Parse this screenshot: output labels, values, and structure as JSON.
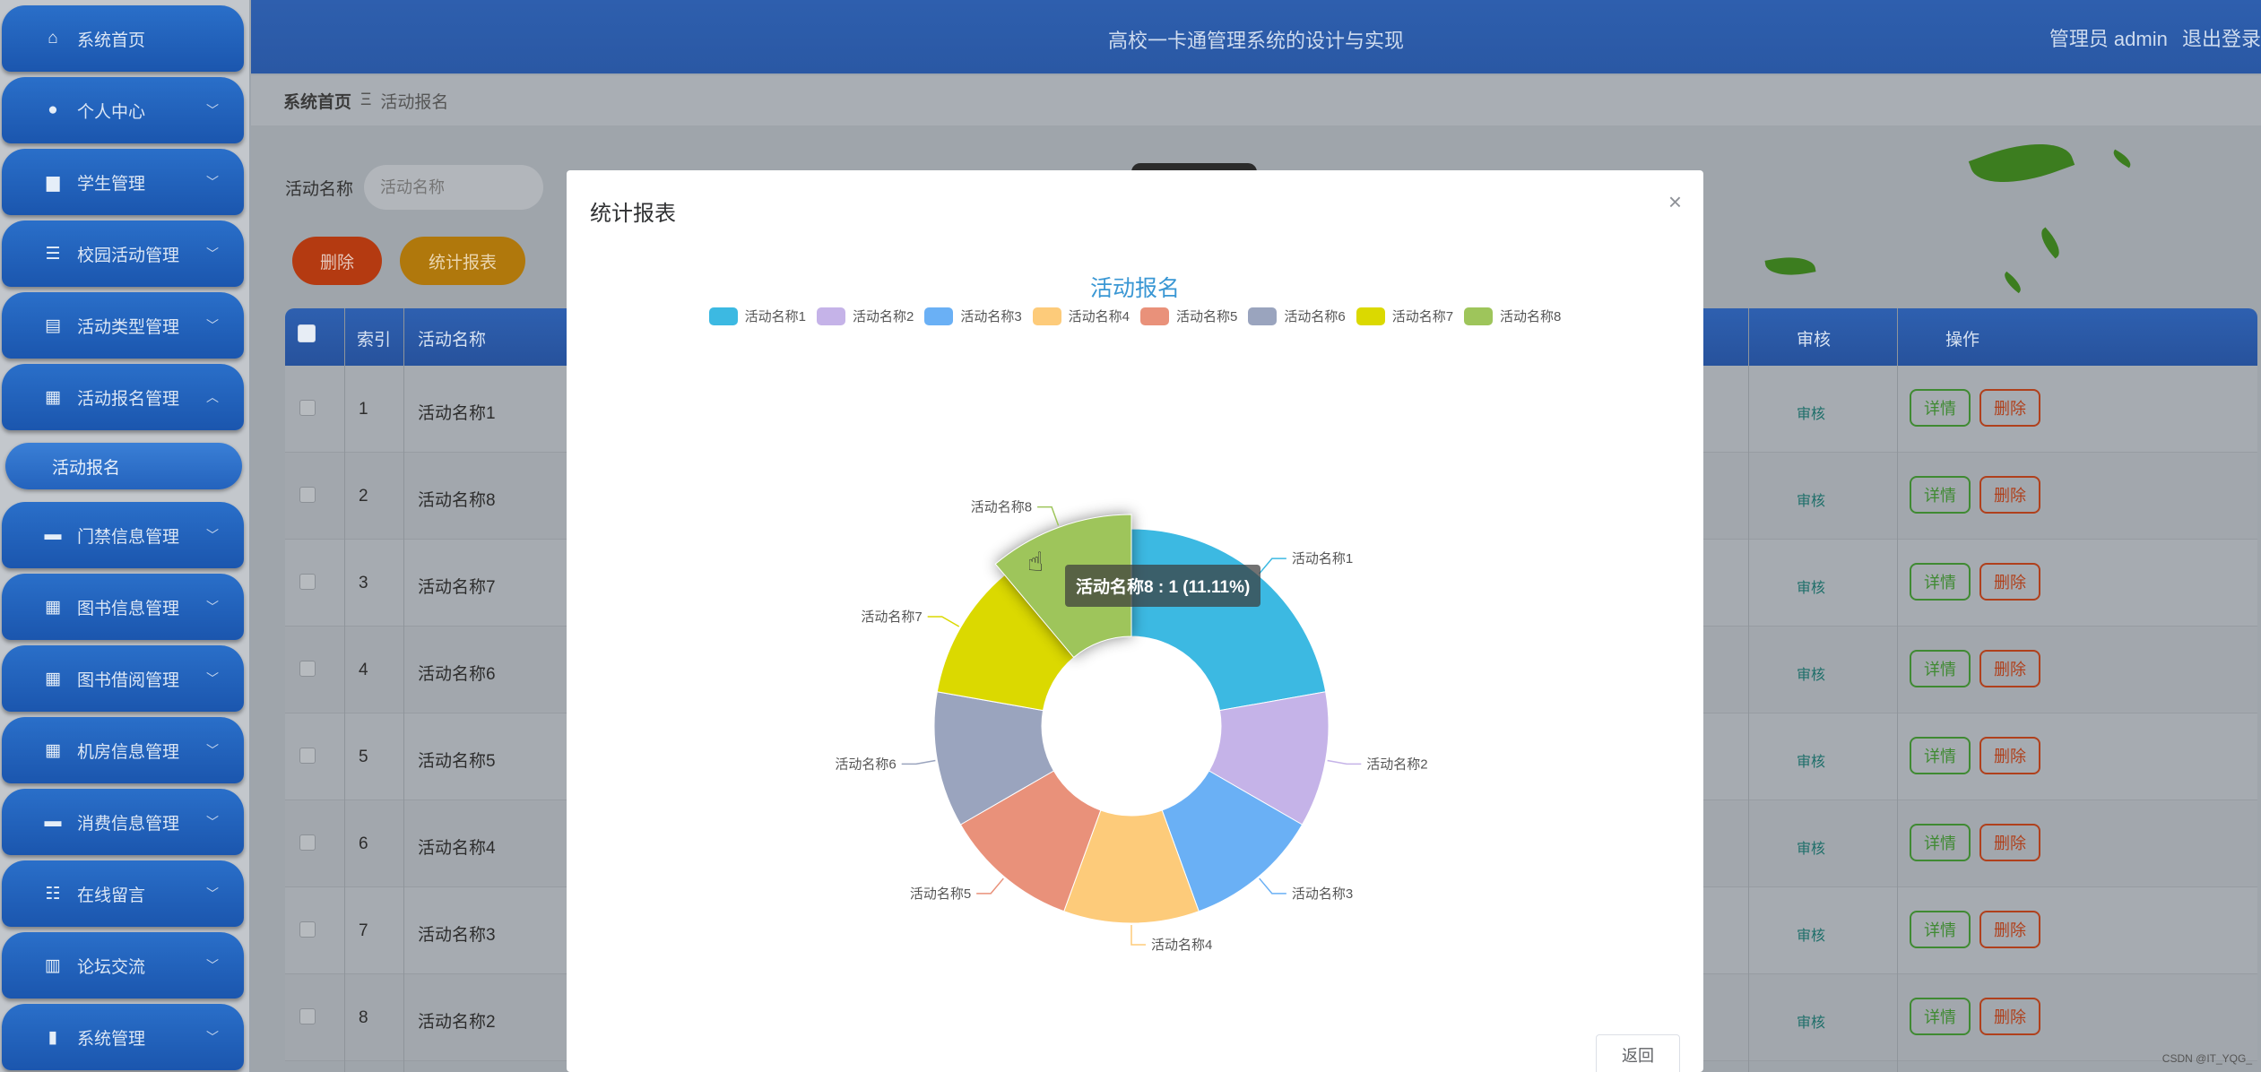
{
  "header": {
    "title": "高校一卡通管理系统的设计与实现",
    "role": "管理员 admin",
    "logout": "退出登录"
  },
  "breadcrumb": {
    "home": "系统首页",
    "sep": "Ξ",
    "current": "活动报名"
  },
  "sidebar": {
    "items": [
      {
        "label": "系统首页",
        "icon": "⌂",
        "chev": ""
      },
      {
        "label": "个人中心",
        "icon": "●",
        "chev": "﹀"
      },
      {
        "label": "学生管理",
        "icon": "▆",
        "chev": "﹀"
      },
      {
        "label": "校园活动管理",
        "icon": "☰",
        "chev": "﹀"
      },
      {
        "label": "活动类型管理",
        "icon": "▤",
        "chev": "﹀"
      },
      {
        "label": "活动报名管理",
        "icon": "▦",
        "chev": "︿"
      },
      {
        "label": "门禁信息管理",
        "icon": "▬",
        "chev": "﹀"
      },
      {
        "label": "图书信息管理",
        "icon": "▦",
        "chev": "﹀"
      },
      {
        "label": "图书借阅管理",
        "icon": "▦",
        "chev": "﹀"
      },
      {
        "label": "机房信息管理",
        "icon": "▦",
        "chev": "﹀"
      },
      {
        "label": "消费信息管理",
        "icon": "▬",
        "chev": "﹀"
      },
      {
        "label": "在线留言",
        "icon": "☷",
        "chev": "﹀"
      },
      {
        "label": "论坛交流",
        "icon": "▥",
        "chev": "﹀"
      },
      {
        "label": "系统管理",
        "icon": "▮",
        "chev": "﹀"
      }
    ],
    "sub_item": "活动报名"
  },
  "search": {
    "label": "活动名称",
    "placeholder": "活动名称"
  },
  "toolbar": {
    "delete": "删除",
    "report": "统计报表"
  },
  "table": {
    "headers": {
      "index": "索引",
      "name": "活动名称",
      "audit": "审核",
      "ops": "操作"
    },
    "rows": [
      {
        "index": "1",
        "name": "活动名称1",
        "audit": "审核",
        "detail": "详情",
        "del": "删除"
      },
      {
        "index": "2",
        "name": "活动名称8",
        "audit": "审核",
        "detail": "详情",
        "del": "删除"
      },
      {
        "index": "3",
        "name": "活动名称7",
        "audit": "审核",
        "detail": "详情",
        "del": "删除"
      },
      {
        "index": "4",
        "name": "活动名称6",
        "audit": "审核",
        "detail": "详情",
        "del": "删除"
      },
      {
        "index": "5",
        "name": "活动名称5",
        "audit": "审核",
        "detail": "详情",
        "del": "删除"
      },
      {
        "index": "6",
        "name": "活动名称4",
        "audit": "审核",
        "detail": "详情",
        "del": "删除"
      },
      {
        "index": "7",
        "name": "活动名称3",
        "audit": "审核",
        "detail": "详情",
        "del": "删除"
      },
      {
        "index": "8",
        "name": "活动名称2",
        "audit": "审核",
        "detail": "详情",
        "del": "删除"
      }
    ]
  },
  "modal": {
    "title": "统计报表",
    "close": "×",
    "back": "返回",
    "tooltip": "活动名称8 : 1 (11.11%)"
  },
  "chart_data": {
    "type": "pie",
    "variant": "donut",
    "title": "活动报名",
    "legend_position": "top-center",
    "categories": [
      "活动名称1",
      "活动名称2",
      "活动名称3",
      "活动名称4",
      "活动名称5",
      "活动名称6",
      "活动名称7",
      "活动名称8"
    ],
    "values": [
      2,
      1,
      1,
      1,
      1,
      1,
      1,
      1
    ],
    "colors": [
      "#3cb9e2",
      "#c5b3e8",
      "#6ab0f5",
      "#fdcb7a",
      "#e9917a",
      "#9aa4be",
      "#dbd900",
      "#9ec55b"
    ],
    "highlighted": "活动名称8"
  },
  "watermark": "CSDN @IT_YQG_"
}
